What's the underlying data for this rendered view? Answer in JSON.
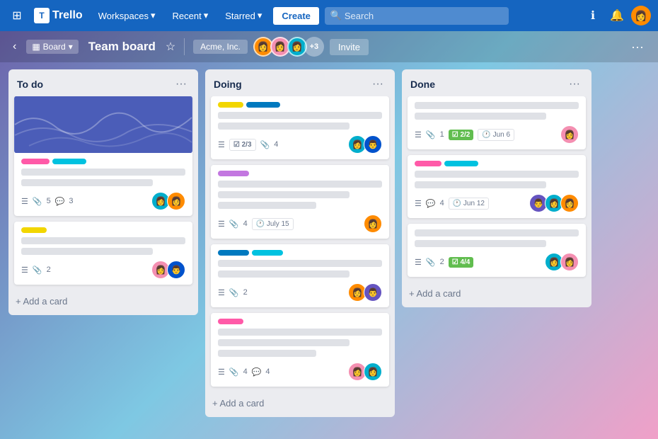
{
  "topnav": {
    "logo_text": "Trello",
    "logo_box": "T",
    "workspaces": "Workspaces",
    "recent": "Recent",
    "starred": "Starred",
    "create": "Create",
    "search_placeholder": "Search"
  },
  "subheader": {
    "board_label": "Board",
    "board_title": "Team board",
    "workspace": "Acme, Inc.",
    "invite": "Invite",
    "plus_count": "+3"
  },
  "lists": [
    {
      "id": "todo",
      "title": "To do",
      "add_label": "+ Add a card",
      "cards": [
        {
          "id": "c1",
          "has_cover": true,
          "labels": [
            "pink",
            "cyan"
          ],
          "lines": [
            "full",
            "medium",
            "short"
          ],
          "meta": {
            "icon": "☰",
            "attach": "5",
            "comment": "3"
          },
          "avatars": [
            "orange",
            "teal"
          ]
        },
        {
          "id": "c2",
          "labels": [
            "yellow"
          ],
          "lines": [
            "full",
            "medium"
          ],
          "meta": {
            "icon": "☰",
            "attach": "2"
          },
          "avatars": [
            "pink",
            "blue"
          ]
        }
      ]
    },
    {
      "id": "doing",
      "title": "Doing",
      "add_label": "+ Add a card",
      "cards": [
        {
          "id": "c3",
          "labels": [
            "yellow",
            "blue"
          ],
          "lines": [
            "full",
            "medium"
          ],
          "meta": {
            "icon": "☰",
            "check": "2/3",
            "attach": "4"
          },
          "avatars": [
            "teal",
            "blue"
          ]
        },
        {
          "id": "c4",
          "labels": [
            "purple"
          ],
          "lines": [
            "full",
            "medium",
            "short"
          ],
          "meta": {
            "icon": "☰",
            "attach": "4",
            "date": "July 15"
          },
          "avatars": [
            "orange"
          ]
        },
        {
          "id": "c5",
          "labels": [
            "blue",
            "cyan"
          ],
          "lines": [
            "full",
            "medium"
          ],
          "meta": {
            "icon": "☰",
            "attach": "2"
          },
          "avatars": [
            "orange",
            "purple"
          ]
        },
        {
          "id": "c6",
          "labels": [
            "pink"
          ],
          "lines": [
            "full",
            "medium",
            "short"
          ],
          "meta": {
            "icon": "☰",
            "attach": "4",
            "comment": "4"
          },
          "avatars": [
            "pink",
            "teal"
          ]
        }
      ]
    },
    {
      "id": "done",
      "title": "Done",
      "add_label": "+ Add a card",
      "cards": [
        {
          "id": "c7",
          "lines": [
            "full",
            "medium"
          ],
          "meta": {
            "icon": "☰",
            "attach": "1",
            "check_green": "2/2",
            "date": "Jun 6"
          },
          "avatars": [
            "pink"
          ]
        },
        {
          "id": "c8",
          "labels": [
            "pink",
            "cyan"
          ],
          "lines": [
            "full",
            "medium"
          ],
          "meta": {
            "icon": "☰",
            "comment": "4",
            "date": "Jun 12"
          },
          "avatars": [
            "purple",
            "teal",
            "orange"
          ]
        },
        {
          "id": "c9",
          "lines": [
            "full",
            "medium"
          ],
          "meta": {
            "icon": "☰",
            "attach": "2",
            "check_green": "4/4"
          },
          "avatars": [
            "teal",
            "pink"
          ]
        }
      ]
    }
  ]
}
